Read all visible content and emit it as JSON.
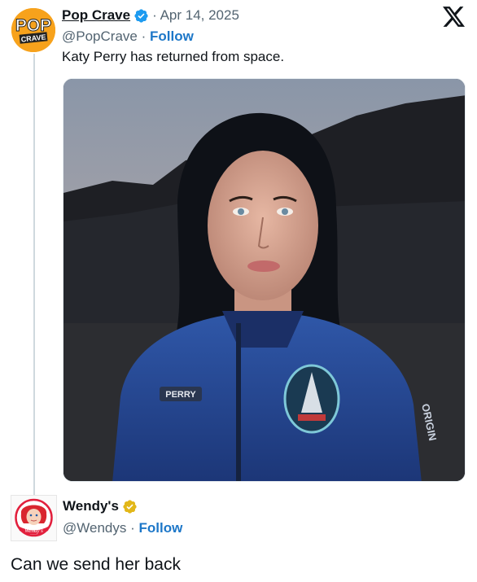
{
  "tweet": {
    "author_name": "Pop Crave",
    "handle": "@PopCrave",
    "separator": "·",
    "date": "Apr 14, 2025",
    "follow_label": "Follow",
    "text": "Katy Perry has returned from space.",
    "avatar_text_top": "POP",
    "avatar_text_bottom": "CRAVE",
    "verified_icon": "blue-check-icon",
    "photo": {
      "patch_text": "PERRY",
      "sleeve_text": "ORIGIN"
    }
  },
  "reply": {
    "author_name": "Wendy's",
    "handle": "@Wendys",
    "separator": "·",
    "follow_label": "Follow",
    "verified_icon": "gold-check-icon",
    "text": "Can we send her back",
    "avatar_text": "Wendy's"
  },
  "brand": {
    "logo_icon": "x-logo-icon"
  },
  "colors": {
    "follow": "#1d77c8",
    "verified_blue": "#1d9bf0",
    "verified_gold": "#e2b719",
    "wendys_red": "#e2203d"
  }
}
